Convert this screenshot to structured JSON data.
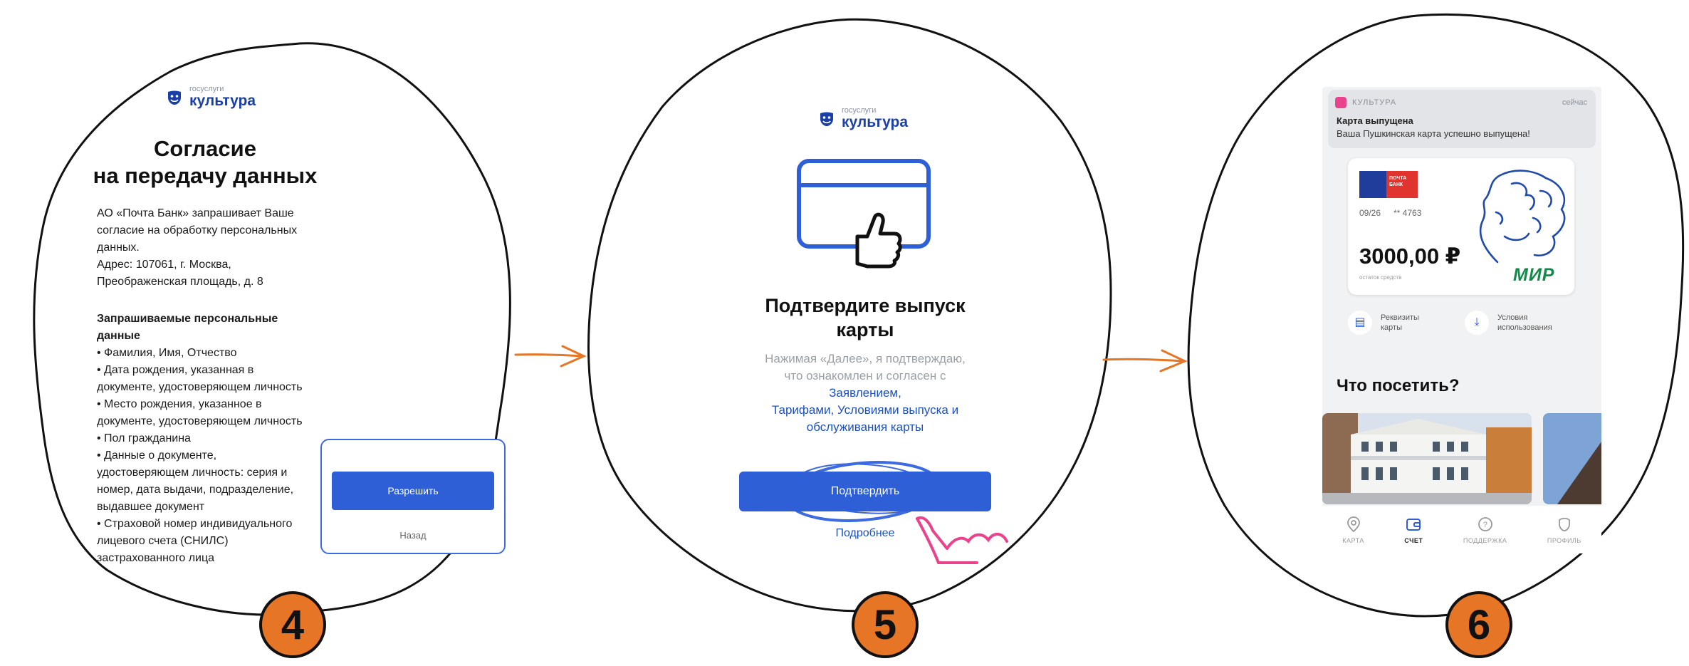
{
  "accent_color": "#2f5fd6",
  "badge_color": "#e67525",
  "annotation_color": "#3d6ae0",
  "arrow_color": "#e67525",
  "hand_color": "#e8438c",
  "brand": {
    "small": "госуслуги",
    "big": "культура"
  },
  "step4": {
    "badge": "4",
    "title_line1": "Согласие",
    "title_line2": "на передачу данных",
    "intro": [
      "АО «Почта Банк» запрашивает Ваше",
      "согласие на обработку персональных",
      "данных.",
      "Адрес: 107061, г. Москва,",
      "Преображенская площадь, д. 8"
    ],
    "section_heading": [
      "Запрашиваемые персональные",
      "данные"
    ],
    "items": [
      "• Фамилия, Имя, Отчество",
      "• Дата рождения, указанная в",
      "документе, удостоверяющем личность",
      "• Место рождения, указанное в",
      "документе, удостоверяющем личность",
      "• Пол гражданина",
      "• Данные о документе,",
      "удостоверяющем личность: серия и",
      "номер, дата выдачи, подразделение,",
      "выдавшее документ",
      "• Страховой номер индивидуального",
      "лицевого счета (СНИЛС)",
      "застрахованного лица"
    ],
    "allow_button": "Разрешить",
    "back_link": "Назад"
  },
  "step5": {
    "badge": "5",
    "title_line1": "Подтвердите выпуск",
    "title_line2": "карты",
    "desc_line1": "Нажимая «Далее», я подтверждаю,",
    "desc_line2": "что ознакомлен и согласен с",
    "link1": "Заявлением,",
    "link2": "Тарифами, Условиями выпуска и",
    "link3": "обслуживания карты",
    "confirm_button": "Подтвердить",
    "more_link": "Подробнее"
  },
  "step6": {
    "badge": "6",
    "notification": {
      "app": "КУЛЬТУРА",
      "time": "сейчас",
      "title": "Карта выпущена",
      "text": "Ваша Пушкинская карта успешно выпущена!"
    },
    "card": {
      "bank_name": "ПОЧТА БАНК",
      "expiry": "09/26",
      "number": "** 4763",
      "balance": "3000,00 ₽",
      "balance_label": "остаток средств",
      "payment_system": "МИР"
    },
    "actions": [
      {
        "label_line1": "Реквизиты",
        "label_line2": "карты",
        "icon": "document-icon"
      },
      {
        "label_line1": "Условия",
        "label_line2": "использования",
        "icon": "download-icon"
      }
    ],
    "section_title": "Что посетить?",
    "tabs": [
      {
        "label": "КАРТА",
        "icon": "map-pin-icon",
        "active": false
      },
      {
        "label": "СЧЕТ",
        "icon": "wallet-icon",
        "active": true
      },
      {
        "label": "ПОДДЕРЖКА",
        "icon": "support-icon",
        "active": false
      },
      {
        "label": "ПРОФИЛЬ",
        "icon": "profile-icon",
        "active": false
      }
    ]
  }
}
